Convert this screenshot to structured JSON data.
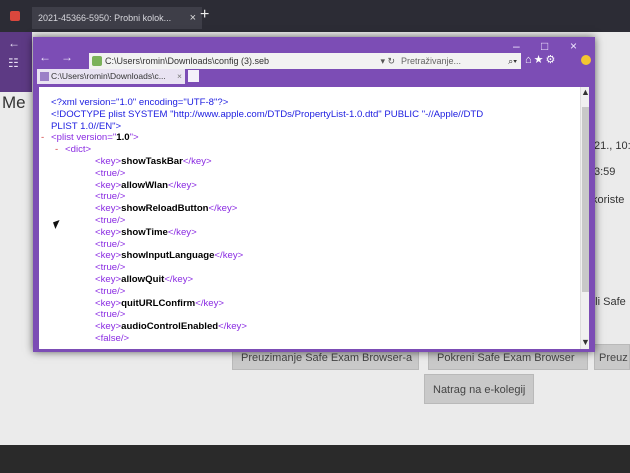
{
  "outer": {
    "tab_title": "2021-45366-5950: Probni kolok...",
    "tab_close": "×",
    "new_tab": "+"
  },
  "background_page": {
    "heading_fragment": "Me",
    "date_fragment": "21., 10:",
    "time_fragment": "3:59",
    "koriste_fragment": "koriste",
    "lisafe_fragment": "e li Safe",
    "buttons": {
      "download_seb": "Preuzimanje Safe Exam Browser-a",
      "launch_seb": "Pokreni Safe Exam Browser",
      "third_fragment": "Preuz",
      "back_elearning": "Natrag na e-kolegij"
    }
  },
  "inner_window": {
    "nav_back": "←",
    "nav_forward": "→",
    "address": "C:\\Users\\romin\\Downloads\\config (3).seb",
    "address_go": "▾ ↻",
    "search_placeholder": "Pretraživanje...",
    "search_icon": "search-icon",
    "controls": {
      "minimize": "–",
      "maximize": "□",
      "close": "×"
    },
    "tools": "⌂★⚙",
    "tab_title": "C:\\Users\\romin\\Downloads\\c...",
    "tab_close": "×"
  },
  "xml_lines": [
    {
      "indent": 0,
      "minus": false,
      "text": "<?xml version=\"1.0\" encoding=\"UTF-8\"?>",
      "kind": "hdr"
    },
    {
      "indent": 0,
      "minus": false,
      "text": "<!DOCTYPE plist SYSTEM \"http://www.apple.com/DTDs/PropertyList-1.0.dtd\" PUBLIC \"-//Apple//DTD",
      "kind": "hdr"
    },
    {
      "indent": 0,
      "minus": false,
      "text": "PLIST 1.0//EN\">",
      "kind": "hdr"
    },
    {
      "indent": 0,
      "minus": true,
      "open": "<plist version=\"",
      "val": "1.0",
      "close": "\">",
      "kind": "plist"
    },
    {
      "indent": 1,
      "minus": true,
      "text": "<dict>",
      "kind": "tag"
    },
    {
      "indent": 2,
      "key": "showTaskBar",
      "kind": "key"
    },
    {
      "indent": 2,
      "text": "<true/>",
      "kind": "tag"
    },
    {
      "indent": 2,
      "key": "allowWlan",
      "kind": "key"
    },
    {
      "indent": 2,
      "text": "<true/>",
      "kind": "tag"
    },
    {
      "indent": 2,
      "key": "showReloadButton",
      "kind": "key"
    },
    {
      "indent": 2,
      "text": "<true/>",
      "kind": "tag"
    },
    {
      "indent": 2,
      "key": "showTime",
      "kind": "key"
    },
    {
      "indent": 2,
      "text": "<true/>",
      "kind": "tag"
    },
    {
      "indent": 2,
      "key": "showInputLanguage",
      "kind": "key"
    },
    {
      "indent": 2,
      "text": "<true/>",
      "kind": "tag"
    },
    {
      "indent": 2,
      "key": "allowQuit",
      "kind": "key"
    },
    {
      "indent": 2,
      "text": "<true/>",
      "kind": "tag"
    },
    {
      "indent": 2,
      "key": "quitURLConfirm",
      "kind": "key"
    },
    {
      "indent": 2,
      "text": "<true/>",
      "kind": "tag"
    },
    {
      "indent": 2,
      "key": "audioControlEnabled",
      "kind": "key"
    },
    {
      "indent": 2,
      "text": "<false/>",
      "kind": "tag"
    }
  ]
}
